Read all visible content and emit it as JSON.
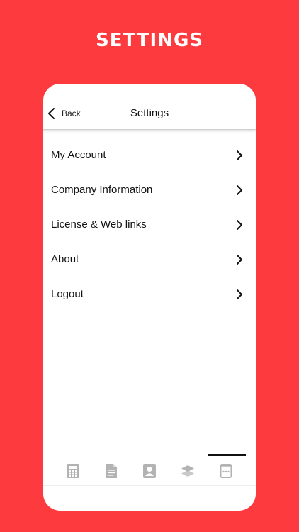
{
  "banner": {
    "title": "SETTINGS"
  },
  "navbar": {
    "back_label": "Back",
    "title": "Settings"
  },
  "menu": {
    "items": [
      {
        "label": "My Account"
      },
      {
        "label": "Company Information"
      },
      {
        "label": "License & Web links"
      },
      {
        "label": "About"
      },
      {
        "label": "Logout"
      }
    ]
  },
  "tabbar": {
    "tabs": [
      {
        "icon": "calculator-icon"
      },
      {
        "icon": "document-icon"
      },
      {
        "icon": "contact-card-icon"
      },
      {
        "icon": "layers-icon"
      },
      {
        "icon": "more-icon",
        "active": true
      }
    ]
  },
  "colors": {
    "background": "#fd3a3e",
    "card": "#ffffff",
    "text": "#111111",
    "inactive_icon": "#b3b3b3",
    "active_indicator": "#111111"
  }
}
